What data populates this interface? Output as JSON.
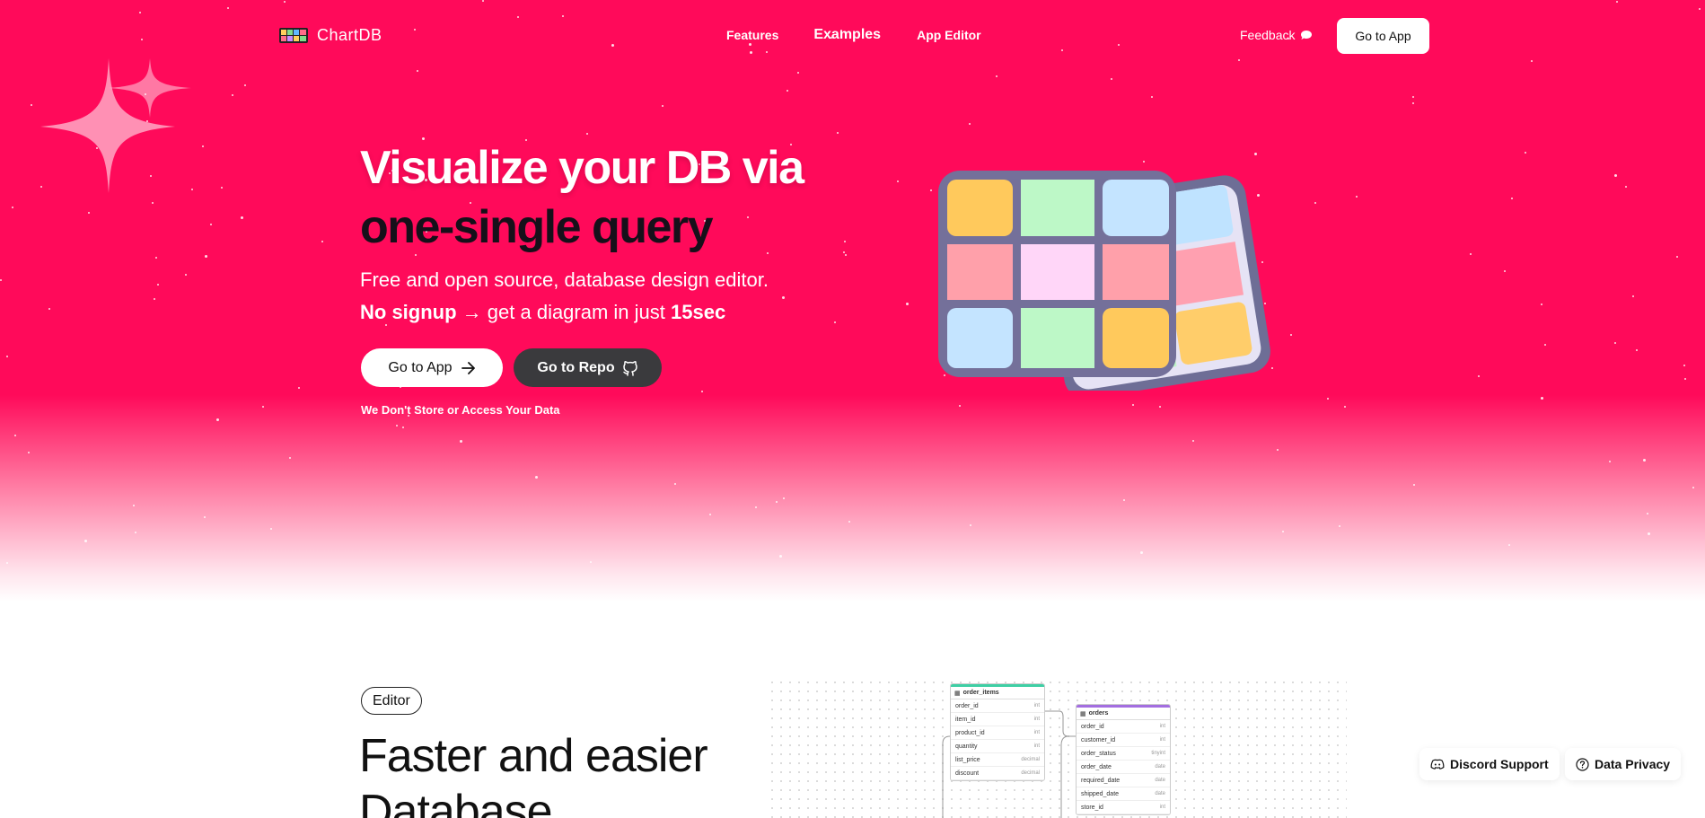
{
  "brand": {
    "name": "ChartDB"
  },
  "nav": {
    "links": [
      "Features",
      "Examples",
      "App Editor"
    ],
    "feedback": "Feedback",
    "go_to_app": "Go to App"
  },
  "hero": {
    "title_line1": "Visualize your DB via",
    "title_line2": "one-single query",
    "subtitle": "Free and open source, database design editor.",
    "sub2_bold": "No signup",
    "sub2_mid": "→ get a diagram in just",
    "sub2_bold2": "15sec",
    "btn_app": "Go to App",
    "btn_repo": "Go to Repo",
    "privacy_note": "We Don't Store or Access Your Data"
  },
  "editor_section": {
    "badge": "Editor",
    "heading_line1": "Faster and easier",
    "heading_line2": "Database"
  },
  "diagram": {
    "tables": [
      {
        "name": "order_items",
        "color": "#3ecfa4",
        "rows": [
          {
            "col": "order_id",
            "type": "int"
          },
          {
            "col": "item_id",
            "type": "int"
          },
          {
            "col": "product_id",
            "type": "int"
          },
          {
            "col": "quantity",
            "type": "int"
          },
          {
            "col": "list_price",
            "type": "decimal"
          },
          {
            "col": "discount",
            "type": "decimal"
          }
        ]
      },
      {
        "name": "orders",
        "color": "#a36ee0",
        "rows": [
          {
            "col": "order_id",
            "type": "int"
          },
          {
            "col": "customer_id",
            "type": "int"
          },
          {
            "col": "order_status",
            "type": "tinyint"
          },
          {
            "col": "order_date",
            "type": "date"
          },
          {
            "col": "required_date",
            "type": "date"
          },
          {
            "col": "shipped_date",
            "type": "date"
          },
          {
            "col": "store_id",
            "type": "int"
          }
        ]
      }
    ]
  },
  "footer_buttons": {
    "discord": "Discord Support",
    "privacy": "Data Privacy"
  },
  "colors": {
    "hero_bg": "#ff0a5a",
    "dark_button": "#3a3a3d"
  }
}
